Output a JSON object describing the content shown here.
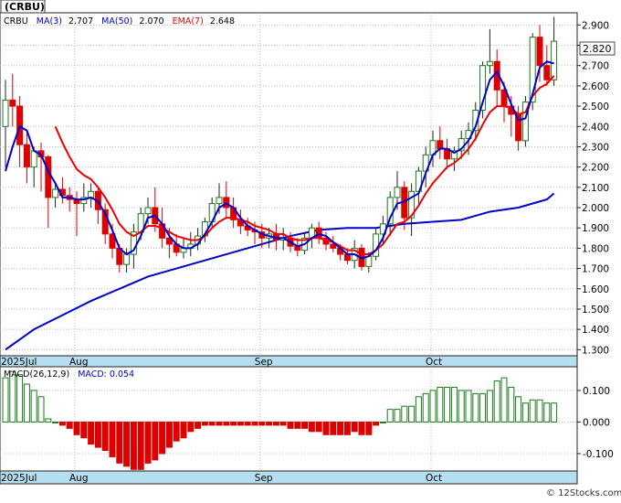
{
  "symbol_badge": "(CRBU)",
  "main_legend": {
    "label": "CRBU",
    "ma3_label": "MA(3)",
    "ma3_value": "2.707",
    "ma50_label": "MA(50)",
    "ma50_value": "2.070",
    "ema7_label": "EMA(7)",
    "ema7_value": "2.648"
  },
  "last_price_label": "2.820",
  "macd_legend": {
    "label": "MACD(26,12,9)",
    "macd_label": "MACD:",
    "macd_value": "0.054"
  },
  "watermark": "© 12Stocks.com",
  "colors": {
    "up_candle": "#1a7a1a",
    "down_candle": "#dd0000",
    "ma3": "#0000cc",
    "ema7": "#ee0000",
    "ma50": "#0000cc",
    "grid": "#bbbbbb",
    "axis_band": "#b5dff0",
    "macd_pos": "#1a7a1a",
    "macd_neg": "#dd0000"
  },
  "chart_data": [
    {
      "type": "candlestick",
      "title": "CRBU",
      "ylim": [
        1.27,
        2.96
      ],
      "y_ticks": [
        "2.900",
        "2.800",
        "2.700",
        "2.600",
        "2.500",
        "2.400",
        "2.300",
        "2.200",
        "2.100",
        "2.000",
        "1.900",
        "1.800",
        "1.700",
        "1.600",
        "1.500",
        "1.400",
        "1.300"
      ],
      "x_tick_labels": [
        "2025Jul",
        "Aug",
        "Sep",
        "Oct"
      ],
      "x_tick_index": [
        0,
        10,
        36,
        60
      ],
      "ohlc": [
        [
          2.4,
          2.63,
          2.2,
          2.53
        ],
        [
          2.53,
          2.66,
          2.4,
          2.5
        ],
        [
          2.5,
          2.55,
          2.2,
          2.31
        ],
        [
          2.31,
          2.38,
          2.12,
          2.2
        ],
        [
          2.2,
          2.3,
          2.1,
          2.28
        ],
        [
          2.28,
          2.32,
          2.08,
          2.25
        ],
        [
          2.25,
          2.26,
          1.9,
          2.05
        ],
        [
          2.05,
          2.12,
          2.0,
          2.09
        ],
        [
          2.09,
          2.15,
          2.02,
          2.06
        ],
        [
          2.06,
          2.1,
          1.98,
          2.04
        ],
        [
          2.04,
          2.08,
          1.86,
          2.02
        ],
        [
          2.02,
          2.12,
          1.98,
          2.05
        ],
        [
          2.05,
          2.12,
          2.0,
          2.08
        ],
        [
          2.08,
          2.1,
          1.92,
          1.99
        ],
        [
          1.99,
          2.02,
          1.82,
          1.87
        ],
        [
          1.87,
          1.92,
          1.75,
          1.8
        ],
        [
          1.8,
          1.82,
          1.68,
          1.72
        ],
        [
          1.72,
          1.8,
          1.68,
          1.77
        ],
        [
          1.77,
          1.92,
          1.7,
          1.88
        ],
        [
          1.88,
          2.0,
          1.84,
          1.97
        ],
        [
          1.97,
          2.05,
          1.92,
          2.0
        ],
        [
          2.0,
          2.1,
          1.88,
          1.92
        ],
        [
          1.92,
          2.0,
          1.8,
          1.85
        ],
        [
          1.85,
          1.9,
          1.75,
          1.82
        ],
        [
          1.82,
          1.87,
          1.76,
          1.78
        ],
        [
          1.78,
          1.85,
          1.75,
          1.8
        ],
        [
          1.8,
          1.88,
          1.76,
          1.82
        ],
        [
          1.82,
          1.9,
          1.79,
          1.86
        ],
        [
          1.86,
          1.95,
          1.83,
          1.93
        ],
        [
          1.93,
          2.05,
          1.9,
          2.02
        ],
        [
          2.02,
          2.12,
          1.97,
          2.05
        ],
        [
          2.05,
          2.13,
          1.95,
          2.0
        ],
        [
          2.0,
          2.05,
          1.9,
          1.94
        ],
        [
          1.94,
          1.99,
          1.87,
          1.91
        ],
        [
          1.91,
          1.95,
          1.86,
          1.89
        ],
        [
          1.89,
          1.93,
          1.82,
          1.88
        ],
        [
          1.88,
          1.92,
          1.8,
          1.85
        ],
        [
          1.85,
          1.9,
          1.8,
          1.87
        ],
        [
          1.87,
          1.92,
          1.79,
          1.84
        ],
        [
          1.84,
          1.9,
          1.79,
          1.85
        ],
        [
          1.85,
          1.88,
          1.78,
          1.81
        ],
        [
          1.81,
          1.85,
          1.76,
          1.79
        ],
        [
          1.79,
          1.88,
          1.77,
          1.85
        ],
        [
          1.85,
          1.92,
          1.8,
          1.9
        ],
        [
          1.9,
          1.93,
          1.82,
          1.85
        ],
        [
          1.85,
          1.88,
          1.79,
          1.82
        ],
        [
          1.82,
          1.86,
          1.78,
          1.8
        ],
        [
          1.8,
          1.82,
          1.74,
          1.77
        ],
        [
          1.77,
          1.8,
          1.72,
          1.74
        ],
        [
          1.74,
          1.84,
          1.7,
          1.8
        ],
        [
          1.8,
          1.82,
          1.69,
          1.71
        ],
        [
          1.71,
          1.78,
          1.68,
          1.76
        ],
        [
          1.76,
          1.9,
          1.74,
          1.87
        ],
        [
          1.87,
          1.96,
          1.82,
          1.92
        ],
        [
          1.92,
          2.08,
          1.86,
          2.05
        ],
        [
          2.05,
          2.18,
          1.99,
          2.1
        ],
        [
          2.1,
          2.13,
          1.89,
          1.95
        ],
        [
          1.95,
          2.12,
          1.86,
          2.08
        ],
        [
          2.08,
          2.2,
          2.02,
          2.18
        ],
        [
          2.18,
          2.3,
          2.1,
          2.26
        ],
        [
          2.26,
          2.38,
          2.2,
          2.33
        ],
        [
          2.33,
          2.4,
          2.24,
          2.29
        ],
        [
          2.29,
          2.34,
          2.19,
          2.24
        ],
        [
          2.24,
          2.3,
          2.18,
          2.28
        ],
        [
          2.28,
          2.38,
          2.24,
          2.34
        ],
        [
          2.34,
          2.42,
          2.26,
          2.38
        ],
        [
          2.38,
          2.52,
          2.33,
          2.48
        ],
        [
          2.48,
          2.72,
          2.44,
          2.7
        ],
        [
          2.7,
          2.88,
          2.66,
          2.72
        ],
        [
          2.72,
          2.78,
          2.5,
          2.58
        ],
        [
          2.58,
          2.62,
          2.42,
          2.5
        ],
        [
          2.5,
          2.55,
          2.35,
          2.46
        ],
        [
          2.46,
          2.5,
          2.28,
          2.33
        ],
        [
          2.33,
          2.55,
          2.3,
          2.52
        ],
        [
          2.52,
          2.86,
          2.48,
          2.84
        ],
        [
          2.84,
          2.9,
          2.62,
          2.7
        ],
        [
          2.7,
          2.8,
          2.6,
          2.63
        ],
        [
          2.63,
          2.94,
          2.6,
          2.82
        ]
      ],
      "ma3": [
        2.18,
        2.3,
        2.4,
        2.38,
        2.28,
        2.26,
        2.18,
        2.12,
        2.05,
        2.05,
        2.04,
        2.04,
        2.05,
        2.03,
        1.97,
        1.89,
        1.8,
        1.77,
        1.79,
        1.86,
        1.95,
        1.96,
        1.92,
        1.86,
        1.82,
        1.8,
        1.8,
        1.82,
        1.87,
        1.93,
        2.0,
        2.02,
        2.0,
        1.95,
        1.91,
        1.89,
        1.87,
        1.86,
        1.85,
        1.85,
        1.83,
        1.81,
        1.82,
        1.85,
        1.87,
        1.86,
        1.83,
        1.8,
        1.77,
        1.77,
        1.75,
        1.76,
        1.79,
        1.85,
        1.95,
        2.02,
        2.03,
        2.05,
        2.07,
        2.17,
        2.26,
        2.29,
        2.29,
        2.27,
        2.29,
        2.33,
        2.4,
        2.52,
        2.63,
        2.67,
        2.6,
        2.51,
        2.43,
        2.44,
        2.56,
        2.69,
        2.72,
        2.71
      ],
      "ema7": [
        null,
        null,
        null,
        null,
        null,
        null,
        null,
        2.4,
        2.32,
        2.25,
        2.19,
        2.16,
        2.14,
        2.1,
        2.05,
        1.99,
        1.92,
        1.88,
        1.86,
        1.88,
        1.91,
        1.91,
        1.9,
        1.88,
        1.86,
        1.85,
        1.84,
        1.84,
        1.86,
        1.9,
        1.93,
        1.95,
        1.95,
        1.94,
        1.93,
        1.91,
        1.9,
        1.89,
        1.87,
        1.87,
        1.85,
        1.84,
        1.84,
        1.85,
        1.85,
        1.84,
        1.83,
        1.81,
        1.79,
        1.79,
        1.77,
        1.77,
        1.79,
        1.82,
        1.87,
        1.92,
        1.93,
        1.96,
        2.01,
        2.07,
        2.12,
        2.16,
        2.2,
        2.22,
        2.25,
        2.29,
        2.34,
        2.41,
        2.47,
        2.5,
        2.5,
        2.49,
        2.46,
        2.47,
        2.55,
        2.59,
        2.61,
        2.65
      ],
      "ma50_points": [
        [
          0,
          1.3
        ],
        [
          4,
          1.4
        ],
        [
          8,
          1.47
        ],
        [
          12,
          1.54
        ],
        [
          16,
          1.6
        ],
        [
          20,
          1.66
        ],
        [
          24,
          1.7
        ],
        [
          28,
          1.74
        ],
        [
          32,
          1.78
        ],
        [
          36,
          1.82
        ],
        [
          40,
          1.86
        ],
        [
          44,
          1.89
        ],
        [
          48,
          1.9
        ],
        [
          52,
          1.9
        ],
        [
          56,
          1.92
        ],
        [
          60,
          1.93
        ],
        [
          64,
          1.94
        ],
        [
          68,
          1.98
        ],
        [
          72,
          2.0
        ],
        [
          76,
          2.04
        ],
        [
          77,
          2.07
        ]
      ],
      "last_price": 2.82
    },
    {
      "type": "bar",
      "title": "MACD(26,12,9)",
      "ylim": [
        -0.155,
        0.175
      ],
      "y_ticks": [
        "0.100",
        "0.000",
        "-0.100"
      ],
      "values": [
        0.14,
        0.16,
        0.15,
        0.12,
        0.1,
        0.08,
        0.01,
        0.0,
        -0.01,
        -0.02,
        -0.04,
        -0.05,
        -0.07,
        -0.08,
        -0.09,
        -0.11,
        -0.13,
        -0.14,
        -0.15,
        -0.15,
        -0.13,
        -0.12,
        -0.1,
        -0.08,
        -0.06,
        -0.05,
        -0.03,
        -0.02,
        -0.01,
        -0.01,
        -0.01,
        -0.01,
        -0.01,
        -0.01,
        -0.01,
        -0.01,
        -0.01,
        -0.01,
        -0.01,
        -0.01,
        -0.02,
        -0.02,
        -0.02,
        -0.03,
        -0.03,
        -0.04,
        -0.04,
        -0.04,
        -0.04,
        -0.03,
        -0.04,
        -0.04,
        -0.01,
        0.0,
        0.04,
        0.04,
        0.05,
        0.05,
        0.08,
        0.09,
        0.1,
        0.11,
        0.11,
        0.11,
        0.1,
        0.1,
        0.09,
        0.09,
        0.1,
        0.13,
        0.14,
        0.11,
        0.08,
        0.06,
        0.07,
        0.07,
        0.06,
        0.06
      ]
    }
  ]
}
